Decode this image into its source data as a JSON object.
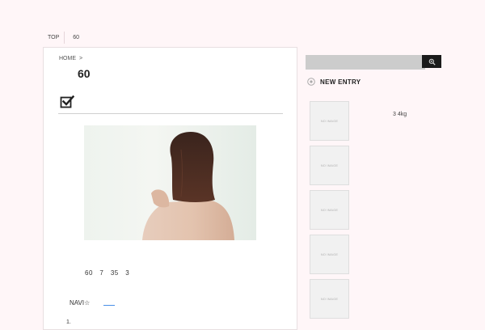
{
  "topnav": {
    "items": [
      "TOP",
      "60"
    ]
  },
  "breadcrumb": {
    "home": "HOME",
    "separator": ">"
  },
  "article": {
    "title": "60",
    "body": "60　7　35　3",
    "navi_label": "NAVI☆",
    "list_number": "1."
  },
  "sidebar": {
    "search": {
      "placeholder": ""
    },
    "new_entry": {
      "heading": "NEW ENTRY",
      "entries": [
        {
          "thumb": "NO IMAGE",
          "text": "3 4kg"
        },
        {
          "thumb": "NO IMAGE",
          "text": ""
        },
        {
          "thumb": "NO IMAGE",
          "text": ""
        },
        {
          "thumb": "NO IMAGE",
          "text": ""
        },
        {
          "thumb": "NO IMAGE",
          "text": ""
        }
      ]
    }
  },
  "colors": {
    "page_bg": "#fff6f8",
    "search_bg": "#cccccc",
    "search_button": "#1b1b1b",
    "link": "#4a8fe7"
  },
  "icons": [
    "checkbox-icon",
    "magnifier-icon",
    "circle-arrow-icon"
  ]
}
